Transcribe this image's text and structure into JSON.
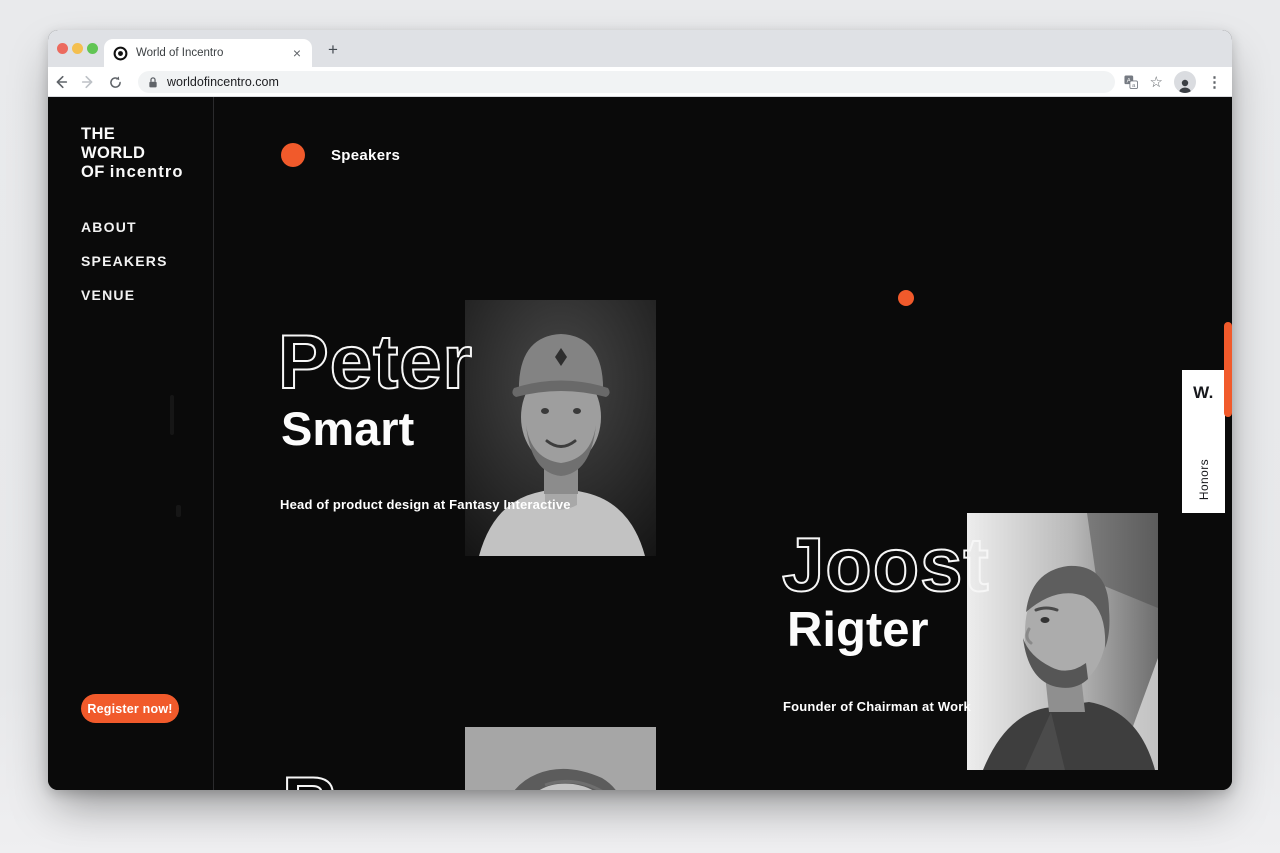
{
  "colors": {
    "accent": "#F15A2B",
    "page_background": "#0A0A0A"
  },
  "browser": {
    "tab_title": "World of Incentro",
    "tab_close_glyph": "×",
    "new_tab_glyph": "+",
    "url": "worldofincentro.com",
    "star_glyph": "☆",
    "menu_glyph": "⋮"
  },
  "sidebar": {
    "logo": {
      "line1": "THE",
      "line2": "WORLD",
      "line3_prefix": "OF ",
      "brand": "incentro"
    },
    "nav": [
      {
        "label": "ABOUT"
      },
      {
        "label": "SPEAKERS"
      },
      {
        "label": "VENUE"
      }
    ],
    "register_button": "Register now!"
  },
  "content": {
    "section_label": "Speakers",
    "speakers": [
      {
        "first_name": "Peter",
        "last_name": "Smart",
        "role": "Head of product design at Fantasy Interactive"
      },
      {
        "first_name": "Joost",
        "last_name": "Rigter",
        "role": "Founder of Chairman at Work"
      },
      {
        "first_name_partial": "R"
      }
    ]
  },
  "awards_badge": {
    "logo": "W.",
    "label": "Honors"
  }
}
